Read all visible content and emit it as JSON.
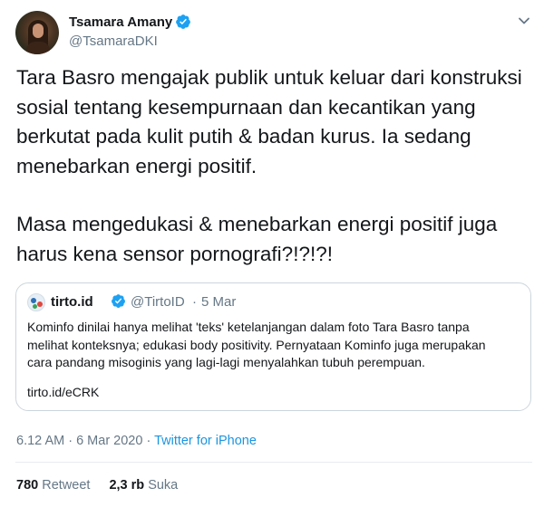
{
  "author": {
    "name": "Tsamara Amany",
    "handle": "@TsamaraDKI",
    "verified_icon": "verified-badge"
  },
  "tweet_text": {
    "lines_p1": [
      "Tara Basro mengajak publik untuk keluar dari konstruksi",
      "sosial tentang kesempurnaan dan kecantikan yang",
      "berkutat pada kulit putih & badan kurus. Ia sedang",
      "menebarkan energi positif."
    ],
    "lines_p2": [
      "Masa mengedukasi & menebarkan energi positif juga",
      "harus kena sensor pornografi?!?!?!"
    ]
  },
  "quoted_tweet": {
    "name": "tirto.id",
    "handle": "@TirtoID",
    "separator": "·",
    "date": "5 Mar",
    "lines": [
      "Kominfo dinilai hanya melihat 'teks' ketelanjangan dalam foto Tara Basro tanpa",
      "melihat konteksnya; edukasi body positivity. Pernyataan Kominfo juga merupakan",
      "cara pandang misoginis yang lagi-lagi menyalahkan tubuh perempuan."
    ],
    "link": "tirto.id/eCRK"
  },
  "meta": {
    "timestamp": "6.12 AM · 6 Mar 2020 · ",
    "via": "Twitter for iPhone"
  },
  "stats": {
    "retweets_count": "780",
    "retweets_label": "Retweet",
    "likes_count": "2,3 rb",
    "likes_label": "Suka"
  },
  "colors": {
    "accent": "#1b95e0",
    "verified": "#1da1f2",
    "muted": "#657786",
    "border": "#ccd6dd"
  }
}
